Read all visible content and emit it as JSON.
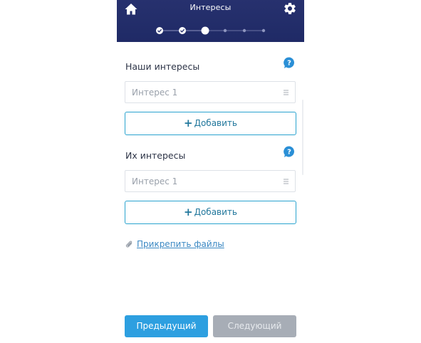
{
  "header": {
    "title": "Интересы",
    "home_icon": "home-icon",
    "settings_icon": "gear-icon",
    "background": "#27316e"
  },
  "stepper": {
    "total_steps": 6,
    "current_step": 3,
    "completed_steps": 2
  },
  "sections": [
    {
      "title": "Наши интересы",
      "items": [
        {
          "placeholder": "Интерес 1"
        }
      ],
      "add_label": "Добавить"
    },
    {
      "title": "Их интересы",
      "items": [
        {
          "placeholder": "Интерес 1"
        }
      ],
      "add_label": "Добавить"
    }
  ],
  "attach": {
    "label": "Прикрепить файлы",
    "icon": "paperclip-icon"
  },
  "footer": {
    "prev_label": "Предыдущий",
    "next_label": "Следующий",
    "prev_color": "#2d9fe0",
    "next_color": "#a7adb6",
    "next_enabled": false
  },
  "colors": {
    "accent": "#2aa3cf",
    "help_icon": "#2a8fd6",
    "link": "#3b88c3"
  }
}
